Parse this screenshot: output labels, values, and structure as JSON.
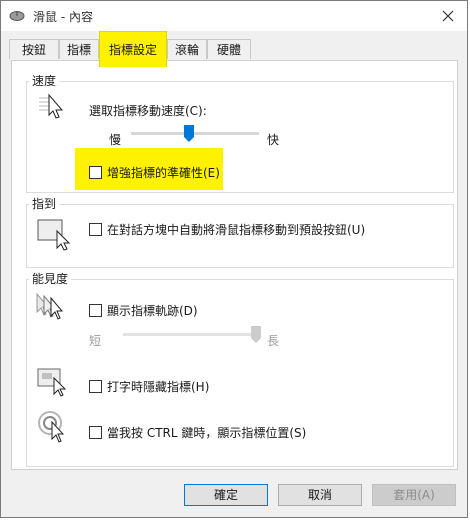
{
  "window": {
    "title": "滑鼠 - 內容"
  },
  "tabs": [
    {
      "label": "按鈕"
    },
    {
      "label": "指標"
    },
    {
      "label": "指標設定",
      "active": true
    },
    {
      "label": "滾輪"
    },
    {
      "label": "硬體"
    }
  ],
  "speed": {
    "title": "速度",
    "select_label": "選取指標移動速度(C):",
    "slow_label": "慢",
    "fast_label": "快",
    "slider_value": 0.45,
    "enhance_label": "增強指標的準確性(E)",
    "enhance_checked": false
  },
  "snap": {
    "title": "指到",
    "label": "在對話方塊中自動將滑鼠指標移動到預設按鈕(U)",
    "checked": false
  },
  "visibility": {
    "title": "能見度",
    "trails_label": "顯示指標軌跡(D)",
    "trails_checked": false,
    "short_label": "短",
    "long_label": "長",
    "trails_slider_value": 1.0,
    "hide_typing_label": "打字時隱藏指標(H)",
    "hide_typing_checked": false,
    "show_location_label": "當我按 CTRL 鍵時，顯示指標位置(S)",
    "show_location_checked": false
  },
  "buttons": {
    "ok": "確定",
    "cancel": "取消",
    "apply": "套用(A)"
  },
  "colors": {
    "highlight": "#fff200",
    "accent": "#0078d7"
  },
  "icons": {
    "title": "mouse-icon",
    "close": "close-icon",
    "speed": "pointer-speed-icon",
    "snap": "snap-to-icon",
    "trails": "pointer-trails-icon",
    "hide": "hide-while-typing-icon",
    "location": "show-location-icon"
  }
}
